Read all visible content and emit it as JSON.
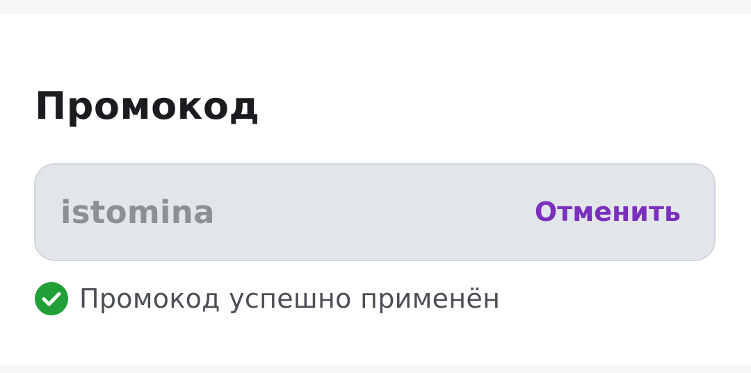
{
  "promo": {
    "title": "Промокод",
    "code_value": "istomina",
    "cancel_label": "Отменить",
    "status_text": "Промокод успешно применён",
    "status_icon": "check-circle-icon",
    "colors": {
      "accent": "#7b2fbe",
      "success": "#21a038",
      "field_bg": "#e2e5e9"
    }
  }
}
